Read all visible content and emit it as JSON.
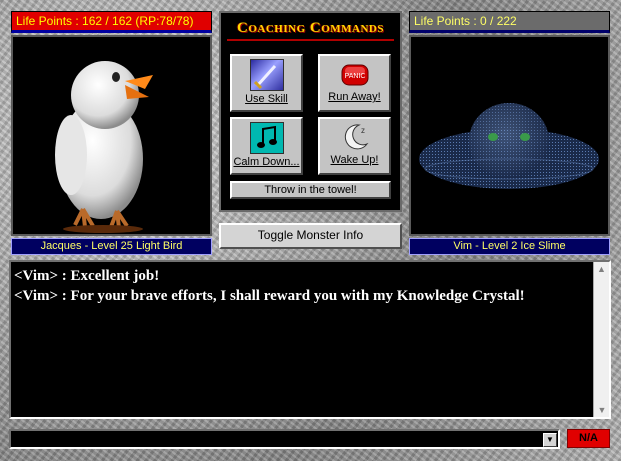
{
  "player": {
    "life_text": "Life Points : 162 / 162 (RP:78/78)",
    "name_text": "Jacques - Level 25 Light Bird"
  },
  "enemy": {
    "life_text": "Life Points : 0 / 222",
    "name_text": "Vim - Level 2 Ice Slime"
  },
  "coaching": {
    "title": "Coaching Commands",
    "use_skill": "Use Skill",
    "run_away": "Run Away!",
    "panic_text": "PANIC",
    "calm_down": "Calm Down...",
    "wake_up": "Wake Up!",
    "throw_towel": "Throw in the towel!"
  },
  "toggle_label": "Toggle Monster Info",
  "chat": {
    "line1": "<Vim> : Excellent job!",
    "line2": "<Vim> : For your brave efforts, I shall reward you with my Knowledge Crystal!"
  },
  "status_na": "N/A",
  "icons": [
    "sword-icon",
    "panic-button-icon",
    "music-note-icon",
    "sleeping-moon-icon",
    "dropdown-arrow-icon"
  ]
}
